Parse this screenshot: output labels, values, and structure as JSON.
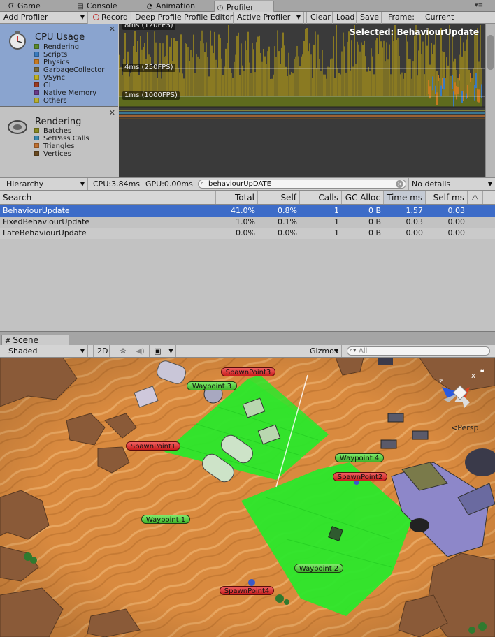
{
  "window_tabs": [
    {
      "label": "Game",
      "icon": "pacman-icon"
    },
    {
      "label": "Console",
      "icon": "console-icon"
    },
    {
      "label": "Animation",
      "icon": "animation-icon"
    },
    {
      "label": "Profiler",
      "icon": "profiler-icon",
      "active": true
    }
  ],
  "toolbar": {
    "add_profiler": "Add Profiler",
    "record": "Record",
    "deep_profile": "Deep Profile",
    "profile_editor": "Profile Editor",
    "active_profiler": "Active Profiler",
    "clear": "Clear",
    "load": "Load",
    "save": "Save",
    "frame_label": "Frame:",
    "frame_value": "Current"
  },
  "modules": {
    "cpu": {
      "title": "CPU Usage",
      "legend": [
        {
          "label": "Rendering",
          "color": "#5a8a2a"
        },
        {
          "label": "Scripts",
          "color": "#3a7bbf"
        },
        {
          "label": "Physics",
          "color": "#c87a20"
        },
        {
          "label": "GarbageCollector",
          "color": "#7a6a3a"
        },
        {
          "label": "VSync",
          "color": "#c0b020"
        },
        {
          "label": "GI",
          "color": "#9a3a20"
        },
        {
          "label": "Native Memory",
          "color": "#6a3a8a"
        },
        {
          "label": "Others",
          "color": "#b8b030"
        }
      ]
    },
    "rendering": {
      "title": "Rendering",
      "legend": [
        {
          "label": "Batches",
          "color": "#8a8a20"
        },
        {
          "label": "SetPass Calls",
          "color": "#3a8ab0"
        },
        {
          "label": "Triangles",
          "color": "#c07030"
        },
        {
          "label": "Vertices",
          "color": "#6a4a20"
        }
      ]
    }
  },
  "graph": {
    "labels": {
      "top": "8ms (120FPS)",
      "mid": "4ms (250FPS)",
      "low": "1ms (1000FPS)"
    },
    "selected": "Selected: BehaviourUpdate"
  },
  "hierarchy_bar": {
    "view": "Hierarchy",
    "cpu": "CPU:3.84ms",
    "gpu": "GPU:0.00ms",
    "search_value": "behaviourUpDATE",
    "details": "No details"
  },
  "table": {
    "columns": [
      "Search",
      "Total",
      "Self",
      "Calls",
      "GC Alloc",
      "Time ms",
      "Self ms"
    ],
    "rows": [
      {
        "name": "BehaviourUpdate",
        "total": "41.0%",
        "self": "0.8%",
        "calls": "1",
        "gc": "0 B",
        "time": "1.57",
        "self_ms": "0.03"
      },
      {
        "name": "FixedBehaviourUpdate",
        "total": "1.0%",
        "self": "0.1%",
        "calls": "1",
        "gc": "0 B",
        "time": "0.03",
        "self_ms": "0.00"
      },
      {
        "name": "LateBehaviourUpdate",
        "total": "0.0%",
        "self": "0.0%",
        "calls": "1",
        "gc": "0 B",
        "time": "0.00",
        "self_ms": "0.00"
      }
    ]
  },
  "scene": {
    "tab": "Scene",
    "shading": "Shaded",
    "mode_2d": "2D",
    "gizmos": "Gizmos",
    "search_placeholder": "All",
    "persp": "Persp",
    "gizmo_axes": {
      "x": "x",
      "z": "z"
    },
    "markers": [
      {
        "label": "SpawnPoint3",
        "kind": "red"
      },
      {
        "label": "Waypoint 3",
        "kind": "green"
      },
      {
        "label": "SpawnPoint1",
        "kind": "red"
      },
      {
        "label": "Waypoint 4",
        "kind": "green"
      },
      {
        "label": "SpawnPoint2",
        "kind": "red"
      },
      {
        "label": "Waypoint 1",
        "kind": "green"
      },
      {
        "label": "Waypoint 2",
        "kind": "green"
      },
      {
        "label": "SpawnPoint4",
        "kind": "red"
      }
    ]
  }
}
